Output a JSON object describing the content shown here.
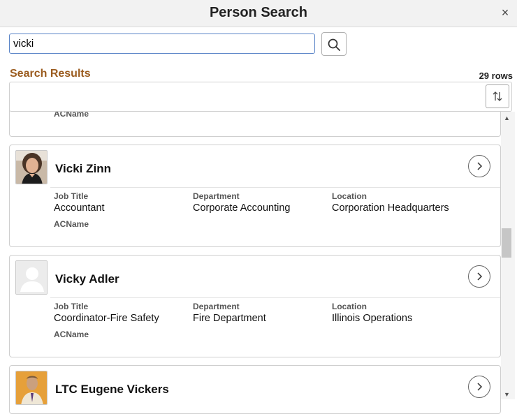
{
  "header": {
    "title": "Person Search",
    "close_glyph": "×"
  },
  "search": {
    "value": "vicki",
    "button_icon": "search-icon"
  },
  "results": {
    "title": "Search Results",
    "rows_label": "29 rows",
    "sort_icon": "sort-icon",
    "field_labels": {
      "job_title": "Job Title",
      "department": "Department",
      "location": "Location",
      "acname": "ACName"
    },
    "people": [
      {
        "name": "Vicki Zinn",
        "job_title": "Accountant",
        "department": "Corporate Accounting",
        "location": "Corporation Headquarters",
        "acname": "ACName",
        "photo": "photo"
      },
      {
        "name": "Vicky Adler",
        "job_title": "Coordinator-Fire Safety",
        "department": "Fire Department",
        "location": "Illinois Operations",
        "acname": "ACName",
        "photo": "placeholder"
      },
      {
        "name": "LTC Eugene Vickers",
        "photo": "photo"
      }
    ]
  },
  "colors": {
    "results_title": "#9a5b1e",
    "input_border": "#5b85c8"
  }
}
